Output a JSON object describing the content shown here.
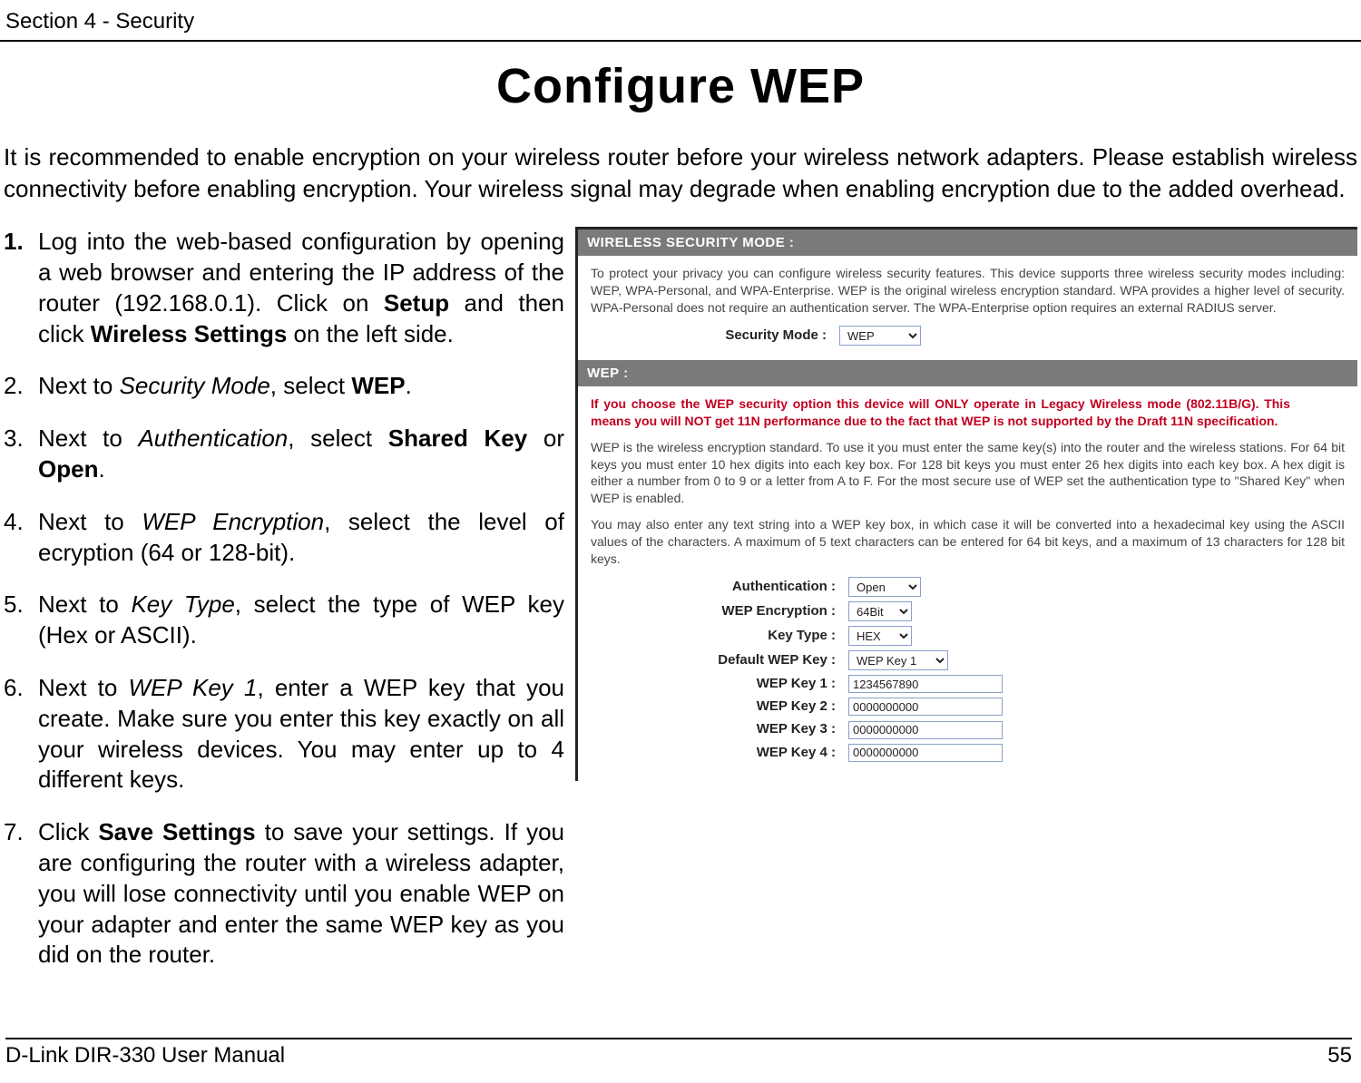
{
  "header": {
    "section": "Section 4 - Security"
  },
  "title": "Configure WEP",
  "intro": "It is recommended to enable encryption on your wireless router before your wireless network adapters. Please establish wireless connectivity before enabling encryption. Your wireless signal may degrade when enabling encryption due to the added overhead.",
  "steps": {
    "s1_num": "1.",
    "s1_a": "Log into the web-based configuration by opening a web browser and entering the IP address of the router (192.168.0.1).  Click on ",
    "s1_b": "Setup",
    "s1_c": " and then click ",
    "s1_d": "Wireless Settings",
    "s1_e": " on the left side.",
    "s2_num": "2.",
    "s2_a": "Next to ",
    "s2_b": "Security Mode",
    "s2_c": ", select ",
    "s2_d": "WEP",
    "s2_e": ".",
    "s3_num": "3.",
    "s3_a": "Next to ",
    "s3_b": "Authentication",
    "s3_c": ", select ",
    "s3_d": "Shared Key",
    "s3_e": " or ",
    "s3_f": "Open",
    "s3_g": ".",
    "s4_num": "4.",
    "s4_a": "Next to ",
    "s4_b": "WEP Encryption",
    "s4_c": ", select the level of ecryption (64 or 128-bit).",
    "s5_num": "5.",
    "s5_a": "Next to ",
    "s5_b": "Key Type",
    "s5_c": ", select the type of WEP key (Hex or ASCII).",
    "s6_num": "6.",
    "s6_a": "Next to ",
    "s6_b": "WEP Key 1",
    "s6_c": ", enter a WEP key that you create. Make sure you enter this key exactly on all your wireless devices. You may enter up to 4 different keys.",
    "s7_num": "7.",
    "s7_a": "Click ",
    "s7_b": "Save Settings",
    "s7_c": " to save your settings. If you are configuring the router with a wireless adapter, you will lose connectivity until you enable WEP on your adapter and enter the same WEP key as you did on the router."
  },
  "shot": {
    "panel1_title": "WIRELESS SECURITY MODE :",
    "panel1_text": "To protect your privacy you can configure wireless security features. This device supports three wireless security modes including: WEP, WPA-Personal, and WPA-Enterprise. WEP is the original wireless encryption standard. WPA provides a higher level of security. WPA-Personal does not require an authentication server. The WPA-Enterprise option requires an external RADIUS server.",
    "security_mode_label": "Security Mode :",
    "security_mode_value": "WEP",
    "panel2_title": "WEP :",
    "warn_text": "If you choose the WEP security option this device will ONLY operate in Legacy Wireless mode (802.11B/G). This means you will NOT get 11N performance due to the fact that WEP is not supported by the Draft 11N specification.",
    "wep_para1": "WEP is the wireless encryption standard. To use it you must enter the same key(s) into the router and the wireless stations. For 64 bit keys you must enter 10 hex digits into each key box. For 128 bit keys you must enter 26 hex digits into each key box. A hex digit is either a number from 0 to 9 or a letter from A to F. For the most secure use of WEP set the authentication type to \"Shared Key\" when WEP is enabled.",
    "wep_para2": "You may also enter any text string into a WEP key box, in which case it will be converted into a hexadecimal key using the ASCII values of the characters. A maximum of 5 text characters can be entered for 64 bit keys, and a maximum of 13 characters for 128 bit keys.",
    "fields": {
      "auth_label": "Authentication :",
      "auth_value": "Open",
      "enc_label": "WEP Encryption :",
      "enc_value": "64Bit",
      "keytype_label": "Key Type :",
      "keytype_value": "HEX",
      "defkey_label": "Default WEP Key :",
      "defkey_value": "WEP Key 1",
      "k1_label": "WEP Key 1 :",
      "k1_value": "1234567890",
      "k2_label": "WEP Key 2 :",
      "k2_value": "0000000000",
      "k3_label": "WEP Key 3 :",
      "k3_value": "0000000000",
      "k4_label": "WEP Key 4 :",
      "k4_value": "0000000000"
    }
  },
  "footer": {
    "left": "D-Link DIR-330 User Manual",
    "right": "55"
  }
}
